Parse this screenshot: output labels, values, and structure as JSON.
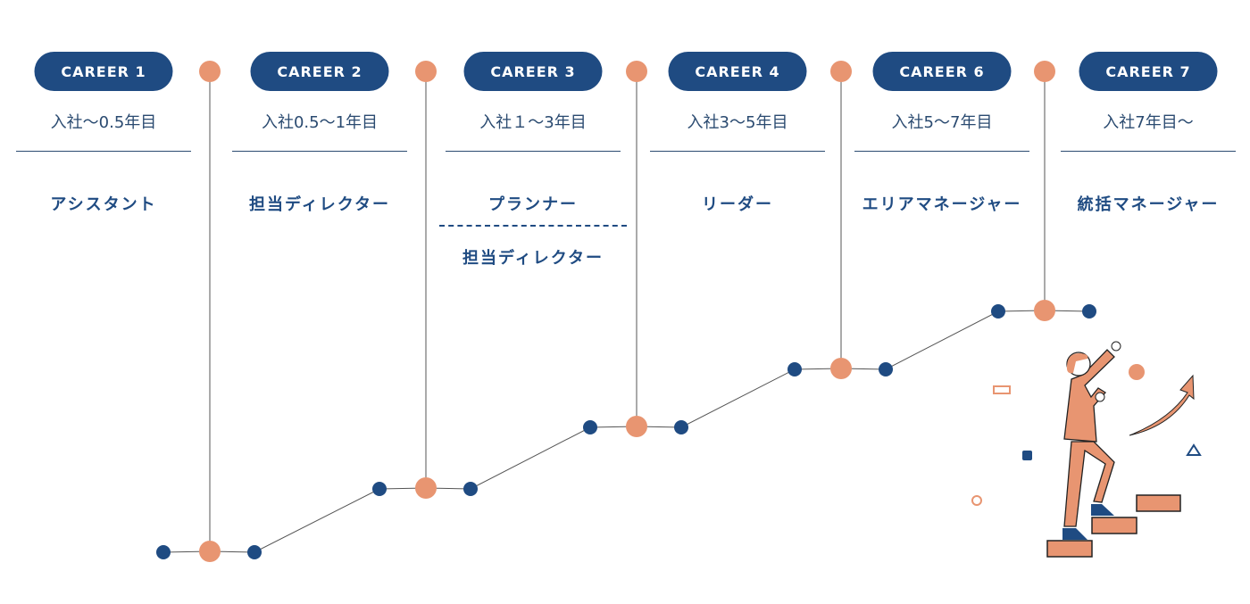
{
  "colors": {
    "navy": "#1f4b82",
    "orange": "#e89571",
    "line": "#555555"
  },
  "careers": [
    {
      "label": "CAREER 1",
      "period": "入社〜0.5年目",
      "role": "アシスタント"
    },
    {
      "label": "CAREER 2",
      "period": "入社0.5〜1年目",
      "role": "担当ディレクター"
    },
    {
      "label": "CAREER 3",
      "period": "入社１〜3年目",
      "role": "プランナー",
      "role2": "担当ディレクター"
    },
    {
      "label": "CAREER 4",
      "period": "入社3〜5年目",
      "role": "リーダー"
    },
    {
      "label": "CAREER 6",
      "period": "入社5〜7年目",
      "role": "エリアマネージャー"
    },
    {
      "label": "CAREER 7",
      "period": "入社7年目〜",
      "role": "統括マネージャー"
    }
  ],
  "illustration": "woman-climbing-stairs-with-up-arrow"
}
